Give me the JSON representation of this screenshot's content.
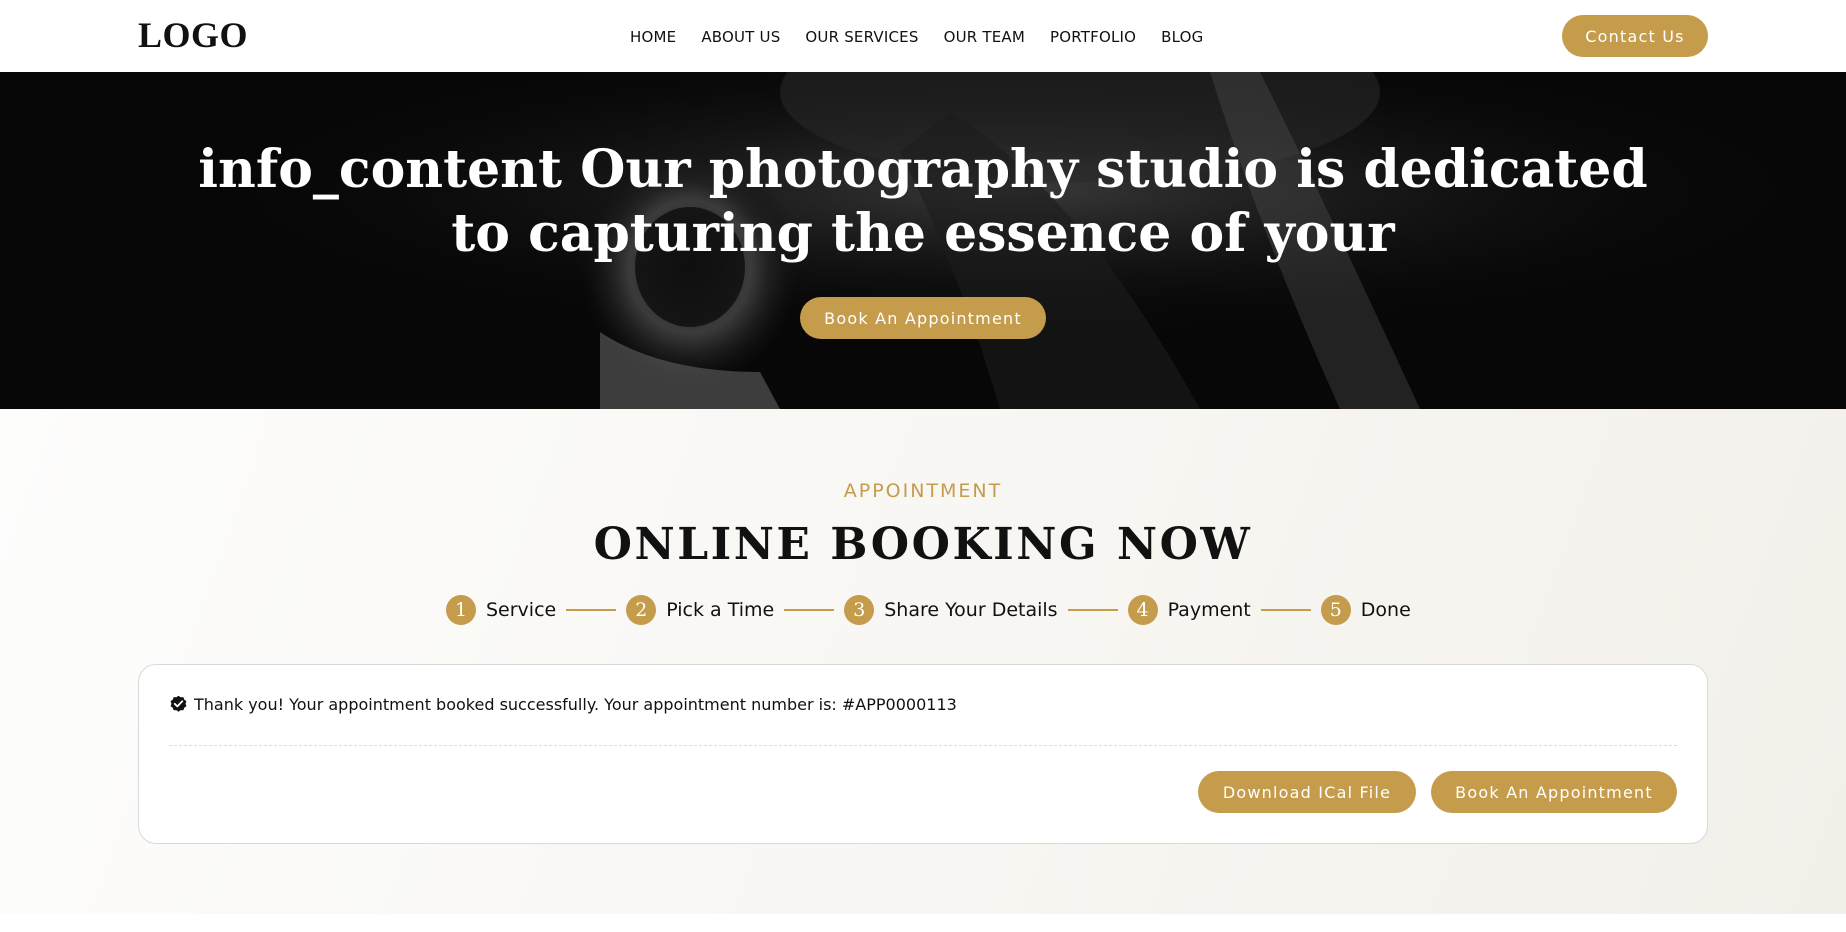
{
  "header": {
    "logo": "LOGO",
    "nav": [
      {
        "label": "HOME"
      },
      {
        "label": "ABOUT US"
      },
      {
        "label": "OUR SERVICES"
      },
      {
        "label": "OUR TEAM"
      },
      {
        "label": "PORTFOLIO"
      },
      {
        "label": "BLOG"
      }
    ],
    "contact_label": "Contact Us"
  },
  "hero": {
    "title_line1": "info_content Our photography studio is dedicated",
    "title_line2": "to capturing the essence of your",
    "cta_label": "Book An Appointment"
  },
  "booking": {
    "eyebrow": "APPOINTMENT",
    "title": "ONLINE BOOKING NOW",
    "steps": [
      {
        "num": "1",
        "label": "Service"
      },
      {
        "num": "2",
        "label": "Pick a Time"
      },
      {
        "num": "3",
        "label": "Share Your Details"
      },
      {
        "num": "4",
        "label": "Payment"
      },
      {
        "num": "5",
        "label": "Done"
      }
    ],
    "success_message": "Thank you! Your appointment booked successfully. Your appointment number is: #APP0000113",
    "success_icon": "check-circle-icon",
    "download_label": "Download ICal File",
    "book_label": "Book An Appointment"
  },
  "colors": {
    "accent": "#c49c4c",
    "hero_bg": "#070707"
  }
}
